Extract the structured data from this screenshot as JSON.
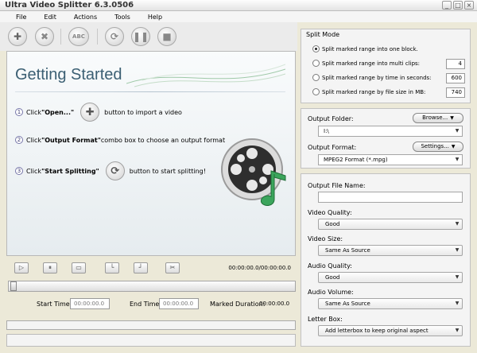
{
  "window": {
    "title": "Ultra Video Splitter 6.3.0506"
  },
  "menu": [
    "File",
    "Edit",
    "Actions",
    "Tools",
    "Help"
  ],
  "toolbar": {
    "abc_label": "ABC"
  },
  "getting_started": {
    "title": "Getting Started",
    "steps": [
      {
        "num": "1",
        "pre": "Click ",
        "bold": "\"Open...\"",
        "post": "button to import a video"
      },
      {
        "num": "2",
        "pre": "Click ",
        "bold": "\"Output Format\"",
        "post": " combo box to choose an output format"
      },
      {
        "num": "3",
        "pre": "Click ",
        "bold": "\"Start Splitting\"",
        "post": "button to start splitting!"
      }
    ]
  },
  "playback": {
    "timecode": "00:00:00.0/00:00:00.0"
  },
  "times": {
    "start_label": "Start Time:",
    "start_value": "00:00:00.0",
    "end_label": "End Time:",
    "end_value": "00:00:00.0",
    "marked_label": "Marked Duration:",
    "marked_value": "00:00:00.0"
  },
  "split_mode": {
    "title": "Split Mode",
    "options": [
      {
        "label": "Split  marked range into one block.",
        "selected": true
      },
      {
        "label": "Split marked range into multi clips:",
        "value": "4"
      },
      {
        "label": "Split marked range by time in seconds:",
        "value": "600"
      },
      {
        "label": "Split marked range by file size in MB:",
        "value": "740"
      }
    ]
  },
  "output": {
    "folder_label": "Output Folder:",
    "browse_label": "Browse...",
    "folder_value": "I:\\",
    "format_label": "Output Format:",
    "settings_label": "Settings...",
    "format_value": "MPEG2 Format (*.mpg)"
  },
  "options": {
    "file_name_label": "Output File Name:",
    "file_name_value": "",
    "video_quality_label": "Video Quality:",
    "video_quality_value": "Good",
    "video_size_label": "Video Size:",
    "video_size_value": "Same As Source",
    "audio_quality_label": "Audio Quality:",
    "audio_quality_value": "Good",
    "audio_volume_label": "Audio Volume:",
    "audio_volume_value": "Same As Source",
    "letter_box_label": "Letter Box:",
    "letter_box_value": "Add letterbox to keep original aspect"
  }
}
